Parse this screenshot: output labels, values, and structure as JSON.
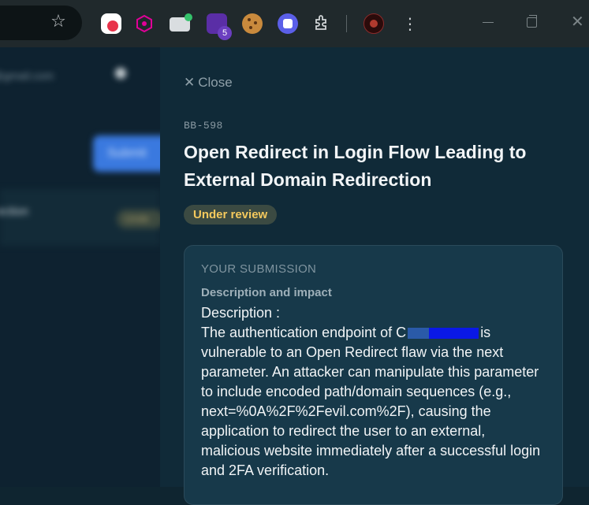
{
  "browser": {
    "icons": [
      "bookmark-star-icon",
      "extension-block-icon",
      "extension-graphql-icon",
      "extension-mail-icon",
      "extension-badge-icon",
      "extension-cookie-icon",
      "extension-shield-icon",
      "extensions-puzzle-icon",
      "profile-avatar",
      "menu-kebab-icon"
    ],
    "ext_badge_count": "5"
  },
  "background": {
    "email": "@gmail.com",
    "submit_label": "Submit",
    "row_title": "ection",
    "row_badge": "Unde"
  },
  "drawer": {
    "close_label": "Close",
    "ticket_id": "BB-598",
    "title": "Open Redirect in Login Flow Leading to External Domain Redirection",
    "status": "Under review",
    "status_color": "#f4c95d",
    "submission": {
      "heading": "YOUR SUBMISSION",
      "sublabel": "Description and impact",
      "desc_label": "Description :",
      "body_before_redaction": "The authentication endpoint of C",
      "body_after_redaction": "is vulnerable to an Open Redirect flaw via the next parameter. An attacker can manipulate this parameter to include encoded path/domain sequences (e.g., next=%0A%2F%2Fevil.com%2F), causing the application to redirect the user to an external, malicious website immediately after a successful login and 2FA verification."
    }
  },
  "colors": {
    "panel_bg": "#102a38",
    "card_bg": "#17394a",
    "badge_bg": "#3b4a42"
  }
}
